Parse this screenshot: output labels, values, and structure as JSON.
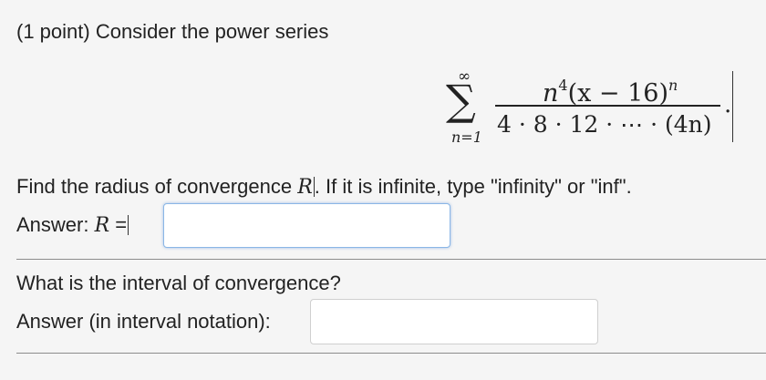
{
  "problem": {
    "intro": "(1 point) Consider the power series"
  },
  "series": {
    "upper_limit": "∞",
    "sigma": "∑",
    "lower_limit": "n=1",
    "numerator": {
      "n": "n",
      "n_exp": "4",
      "base": "(x − 16)",
      "base_exp": "n"
    },
    "denominator": {
      "constants": "4 · 8 · 12 · ⋯ · ",
      "last_term": "(4n)"
    },
    "end_punctuation": "."
  },
  "question1": {
    "text_before": "Find the radius of convergence ",
    "variable": "R",
    "text_after": ". If it is infinite, type \"infinity\" or \"inf\".",
    "answer_prefix": "Answer: ",
    "answer_variable": "R",
    "answer_equals": " =",
    "answer_value": ""
  },
  "question2": {
    "text": "What is the interval of convergence?",
    "answer_label": "Answer (in interval notation):",
    "answer_value": ""
  },
  "colors": {
    "background": "#f5f5f5",
    "input_focus_border": "#8ab6e6",
    "divider": "#8c8c8c"
  }
}
